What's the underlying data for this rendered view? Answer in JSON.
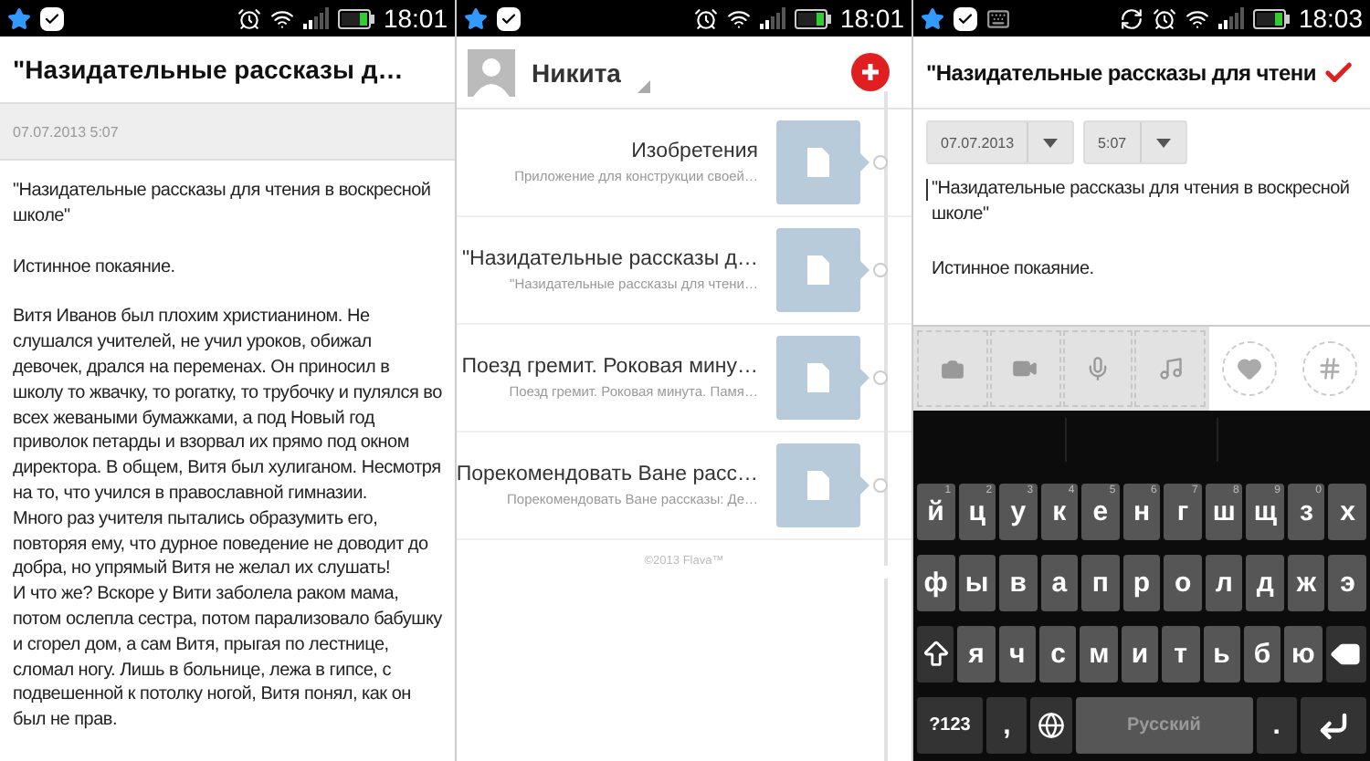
{
  "note_view": {
    "status_bar": {
      "time": "18:01"
    },
    "title": "\"Назидательные рассказы д…",
    "date": "07.07.2013 5:07",
    "blocks": [
      [
        "\"Назидательные рассказы для чтения в воскресной школе\""
      ],
      [
        "Истинное покаяние."
      ],
      [
        "Витя Иванов был плохим христианином. Не слушался учителей, не учил уроков, обижал девочек, дрался на переменах. Он приносил в школу то жвачку, то рогатку, то трубочку и пулялся во всех жеваными бумажками, а под Новый год приволок петарды и взорвал их прямо под окном директора. В общем, Витя был хулиганом. Несмотря на то, что учился в православной гимназии.",
        "Много раз учителя пытались образумить его, повторяя ему, что дурное поведение не доводит до добра, но упрямый Витя не желал их слушать!",
        "И что же? Вскоре у Вити заболела раком мама, потом ослепла сестра, потом парализовало бабушку и сгорел дом, а сам Витя, прыгая по лестнице, сломал ногу. Лишь в больнице, лежа в гипсе, с подвешенной к потолку ногой, Витя понял, как он был не прав."
      ]
    ]
  },
  "notes_list": {
    "status_bar": {
      "time": "18:01"
    },
    "account": "Никита",
    "notes": [
      {
        "title": "Изобретения",
        "preview": "Приложение для конструкции своей…"
      },
      {
        "title": "\"Назидательные рассказы д…",
        "preview": "\"Назидательные рассказы для чтени…"
      },
      {
        "title": "Поезд гремит. Роковая мину…",
        "preview": "Поезд гремит. Роковая минута. Памя…"
      },
      {
        "title": "Порекомендовать Ване расс…",
        "preview": "Порекомендовать Ване рассказы: Де…"
      }
    ],
    "footer": "©2013 Flava™"
  },
  "note_editor": {
    "status_bar": {
      "time": "18:03"
    },
    "title": "\"Назидательные рассказы для чтени",
    "date": "07.07.2013",
    "time": "5:07",
    "blocks": [
      [
        "\"Назидательные рассказы для чтения в воскресной школе\""
      ],
      [
        "Истинное покаяние."
      ]
    ],
    "keyboard": {
      "rows": [
        {
          "keys": [
            {
              "kind": "letter",
              "label": "й",
              "hint": "1"
            },
            {
              "kind": "letter",
              "label": "ц",
              "hint": "2"
            },
            {
              "kind": "letter",
              "label": "у",
              "hint": "3"
            },
            {
              "kind": "letter",
              "label": "к",
              "hint": "4"
            },
            {
              "kind": "letter",
              "label": "е",
              "hint": "5"
            },
            {
              "kind": "letter",
              "label": "н",
              "hint": "6"
            },
            {
              "kind": "letter",
              "label": "г",
              "hint": "7"
            },
            {
              "kind": "letter",
              "label": "ш",
              "hint": "8"
            },
            {
              "kind": "letter",
              "label": "щ",
              "hint": "9"
            },
            {
              "kind": "letter",
              "label": "з",
              "hint": "0"
            },
            {
              "kind": "letter",
              "label": "х"
            }
          ]
        },
        {
          "keys": [
            {
              "kind": "letter",
              "label": "ф"
            },
            {
              "kind": "letter",
              "label": "ы"
            },
            {
              "kind": "letter",
              "label": "в"
            },
            {
              "kind": "letter",
              "label": "а"
            },
            {
              "kind": "letter",
              "label": "п"
            },
            {
              "kind": "letter",
              "label": "р"
            },
            {
              "kind": "letter",
              "label": "о"
            },
            {
              "kind": "letter",
              "label": "л"
            },
            {
              "kind": "letter",
              "label": "д"
            },
            {
              "kind": "letter",
              "label": "ж"
            },
            {
              "kind": "letter",
              "label": "э"
            }
          ]
        },
        {
          "keys": [
            {
              "kind": "shift"
            },
            {
              "kind": "letter",
              "label": "я"
            },
            {
              "kind": "letter",
              "label": "ч"
            },
            {
              "kind": "letter",
              "label": "с"
            },
            {
              "kind": "letter",
              "label": "м"
            },
            {
              "kind": "letter",
              "label": "и"
            },
            {
              "kind": "letter",
              "label": "т"
            },
            {
              "kind": "letter",
              "label": "ь"
            },
            {
              "kind": "letter",
              "label": "б"
            },
            {
              "kind": "letter",
              "label": "ю"
            },
            {
              "kind": "backspace"
            }
          ]
        },
        {
          "keys": [
            {
              "kind": "symbols",
              "label": "?123"
            },
            {
              "kind": "punct",
              "label": ","
            },
            {
              "kind": "globe"
            },
            {
              "kind": "space",
              "label": "Русский"
            },
            {
              "kind": "punct",
              "label": "."
            },
            {
              "kind": "enter"
            }
          ]
        }
      ]
    }
  }
}
